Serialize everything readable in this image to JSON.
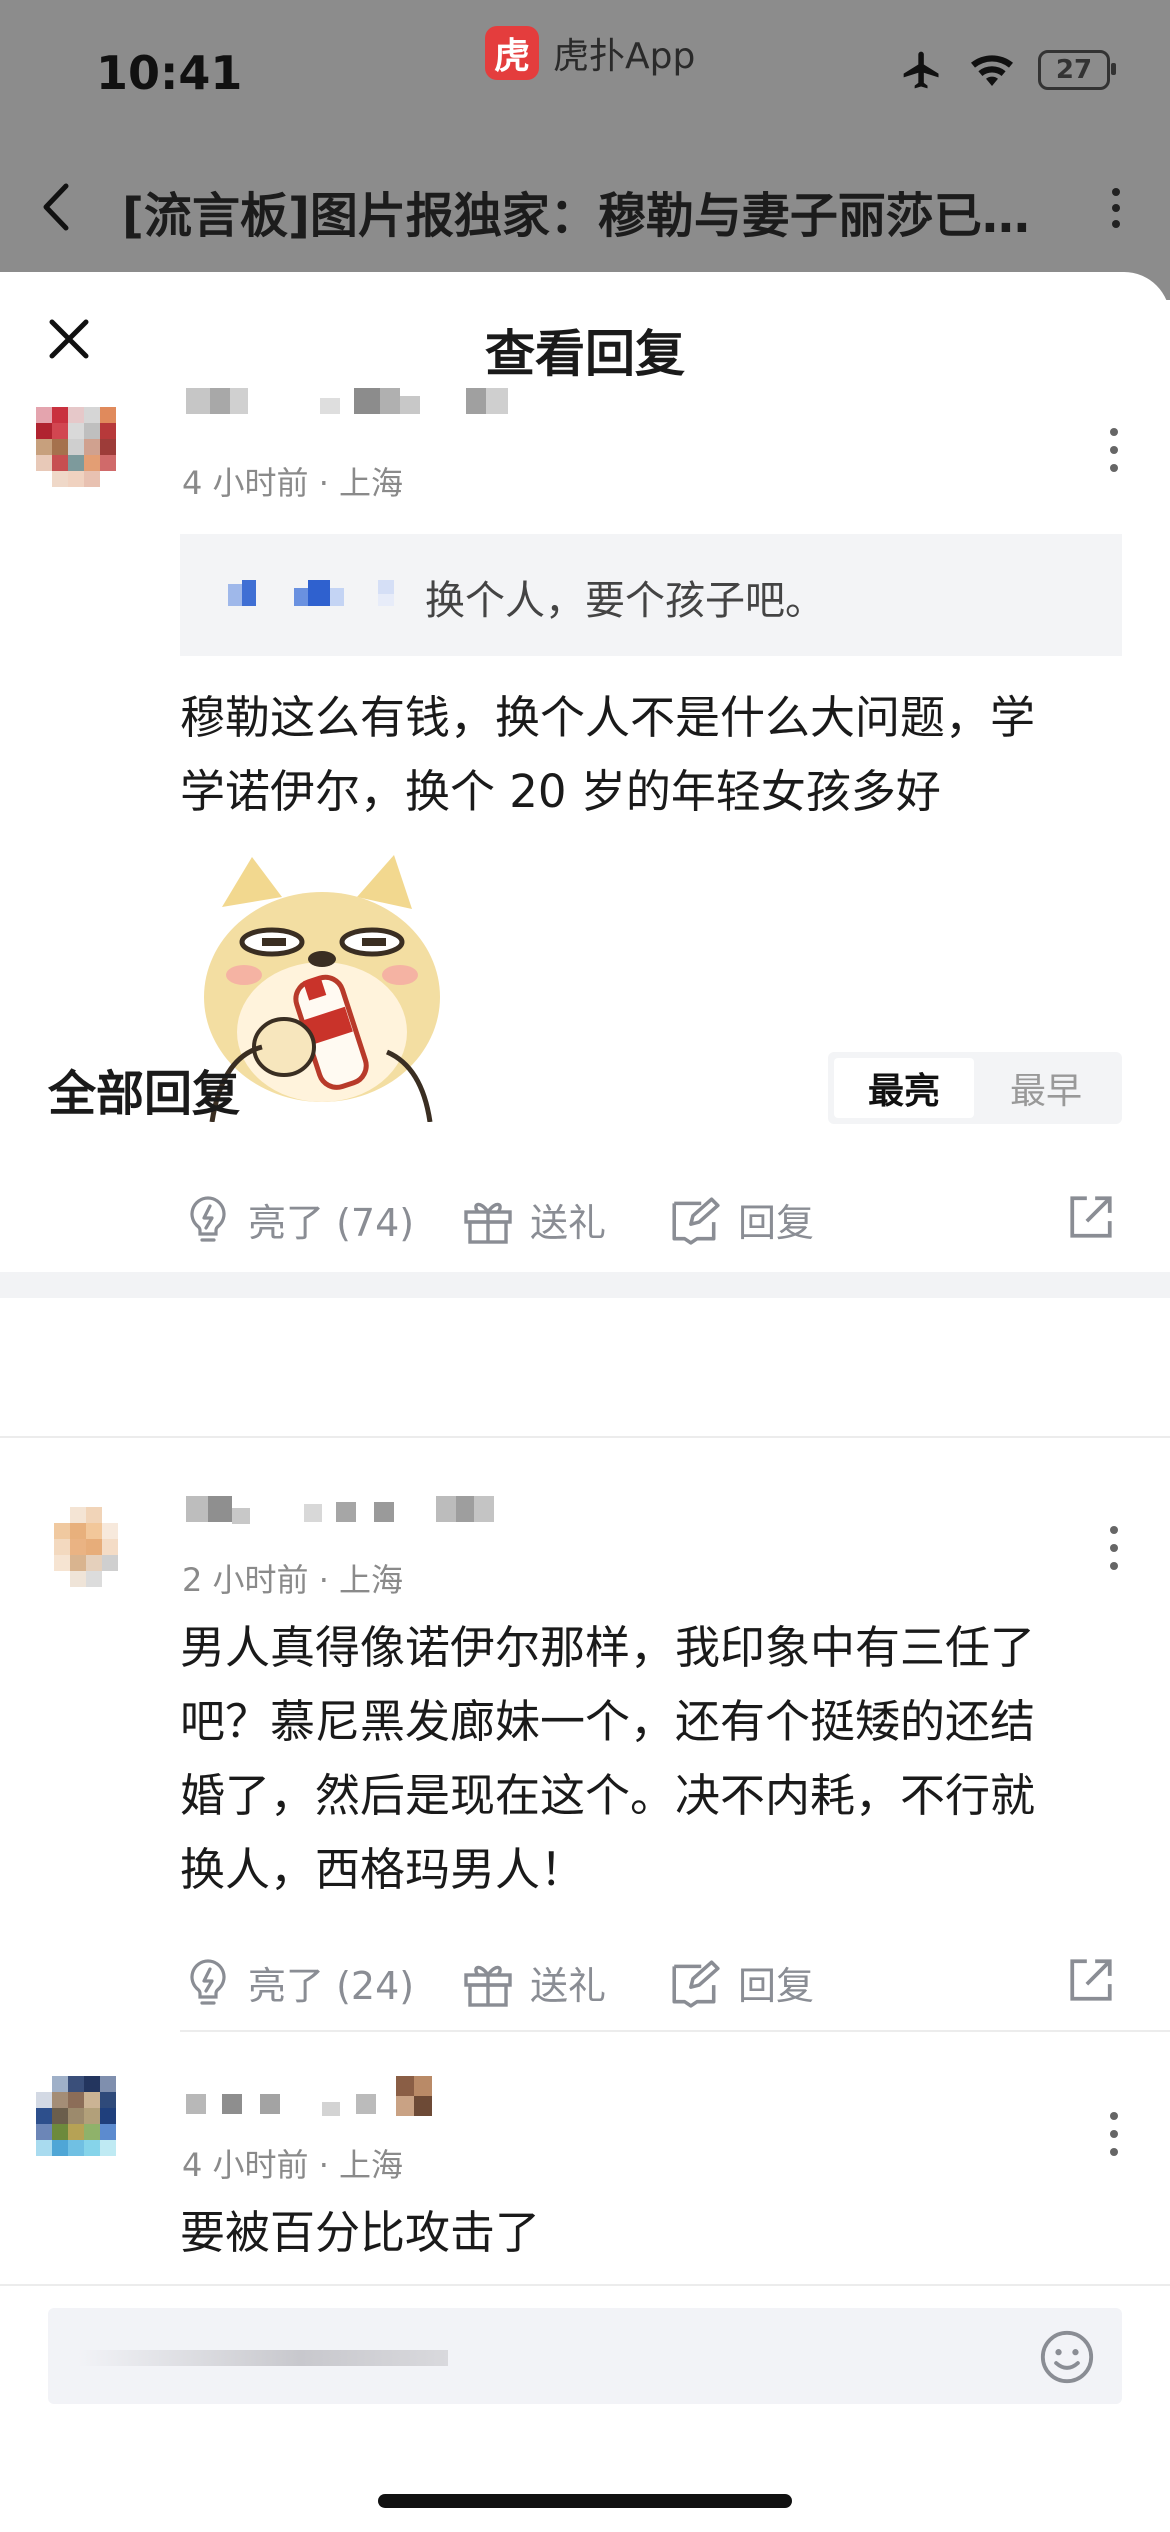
{
  "status_bar": {
    "time": "10:41",
    "app_name": "虎扑App",
    "app_logo_glyph": "虎",
    "battery": "27"
  },
  "nav": {
    "title": "[流言板]图片报独家：穆勒与妻子丽莎已…"
  },
  "sheet": {
    "title": "查看回复"
  },
  "main_comment": {
    "meta": "4 小时前 · 上海",
    "quote": "换个人，要个孩子吧。",
    "body_lines": [
      "穆勒这么有钱，换个人不是什么大问题，学",
      "学诺伊尔，换个 20 岁的年轻女孩多好"
    ],
    "actions": {
      "like": "亮了 (74)",
      "gift": "送礼",
      "reply": "回复"
    }
  },
  "all_replies": {
    "title": "全部回复",
    "sort_hot": "最亮",
    "sort_early": "最早"
  },
  "replies": [
    {
      "meta": "2 小时前 · 上海",
      "body_lines": [
        "男人真得像诺伊尔那样，我印象中有三任了",
        "吧？慕尼黑发廊妹一个，还有个挺矮的还结",
        "婚了，然后是现在这个。决不内耗，不行就",
        "换人，西格玛男人！"
      ],
      "actions": {
        "like": "亮了 (24)",
        "gift": "送礼",
        "reply": "回复"
      }
    },
    {
      "meta": "4 小时前 · 上海",
      "body_lines": [
        "要被百分比攻击了"
      ]
    }
  ],
  "colors": {
    "accent_red": "#e43d3d",
    "icon_gray": "#8a8d94",
    "dim_overlay": "#8c8c8c"
  }
}
